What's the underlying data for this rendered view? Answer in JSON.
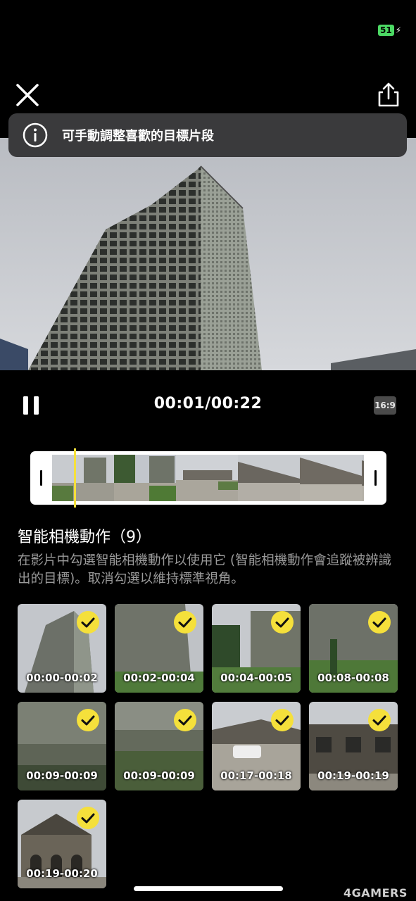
{
  "status": {
    "battery": "51"
  },
  "banner": {
    "text": "可手動調整喜歡的目標片段"
  },
  "player": {
    "time": "00:01/00:22",
    "aspect_ratio": "16:9"
  },
  "section": {
    "title": "智能相機動作（9）",
    "description": "在影片中勾選智能相機動作以使用它 (智能相機動作會追蹤被辨識出的目標)。取消勾選以維持標準視角。"
  },
  "clips": [
    {
      "range": "00:00-00:02",
      "checked": true
    },
    {
      "range": "00:02-00:04",
      "checked": true
    },
    {
      "range": "00:04-00:05",
      "checked": true
    },
    {
      "range": "00:08-00:08",
      "checked": true
    },
    {
      "range": "00:09-00:09",
      "checked": true
    },
    {
      "range": "00:09-00:09",
      "checked": true
    },
    {
      "range": "00:17-00:18",
      "checked": true
    },
    {
      "range": "00:19-00:19",
      "checked": true
    },
    {
      "range": "00:19-00:20",
      "checked": true
    }
  ],
  "icons": {
    "close": "close-icon",
    "share": "share-icon",
    "info": "info-icon",
    "pause": "pause-icon",
    "check": "check-icon"
  },
  "colors": {
    "accent": "#f5e03b",
    "banner_bg": "#3a3a3c",
    "battery": "#4cd964"
  },
  "watermark": "4GAMERS"
}
